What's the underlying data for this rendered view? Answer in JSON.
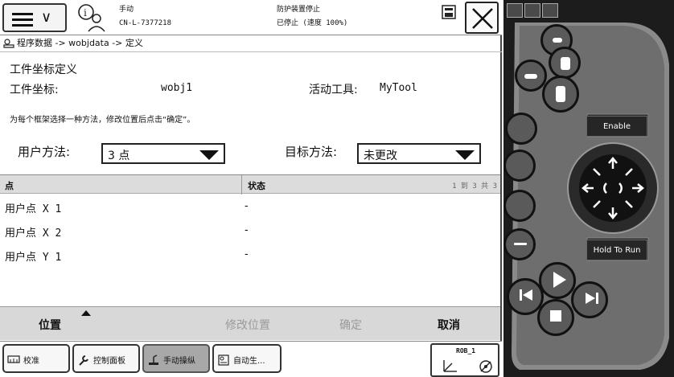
{
  "header": {
    "mode": "手动",
    "controller_id": "CN-L-7377218",
    "safety_status": "防护装置停止",
    "run_status": "已停止 (速度 100%)"
  },
  "breadcrumb": "程序数据 -> wobjdata -> 定义",
  "form": {
    "title": "工件坐标定义",
    "wobj_label": "工件坐标:",
    "wobj_value": "wobj1",
    "tool_label": "活动工具:",
    "tool_value": "MyTool",
    "instruction": "为每个框架选择一种方法，修改位置后点击“确定”。",
    "user_method_label": "用户方法:",
    "user_method_value": "3 点",
    "target_method_label": "目标方法:",
    "target_method_value": "未更改"
  },
  "table": {
    "col_point": "点",
    "col_status": "状态",
    "count": "1 到 3 共 3",
    "rows": [
      {
        "name": "用户点 X 1",
        "status": "-"
      },
      {
        "name": "用户点 X 2",
        "status": "-"
      },
      {
        "name": "用户点 Y 1",
        "status": "-"
      }
    ]
  },
  "toolbar": {
    "position": "位置",
    "modify_position": "修改位置",
    "ok": "确定",
    "cancel": "取消"
  },
  "taskbar": {
    "calibrate": "校准",
    "control_panel": "控制面板",
    "jogging": "手动操纵",
    "auto_production": "自动生...",
    "robot": "ROB_1"
  },
  "pendant": {
    "enable": "Enable",
    "hold_to_run": "Hold To Run"
  }
}
